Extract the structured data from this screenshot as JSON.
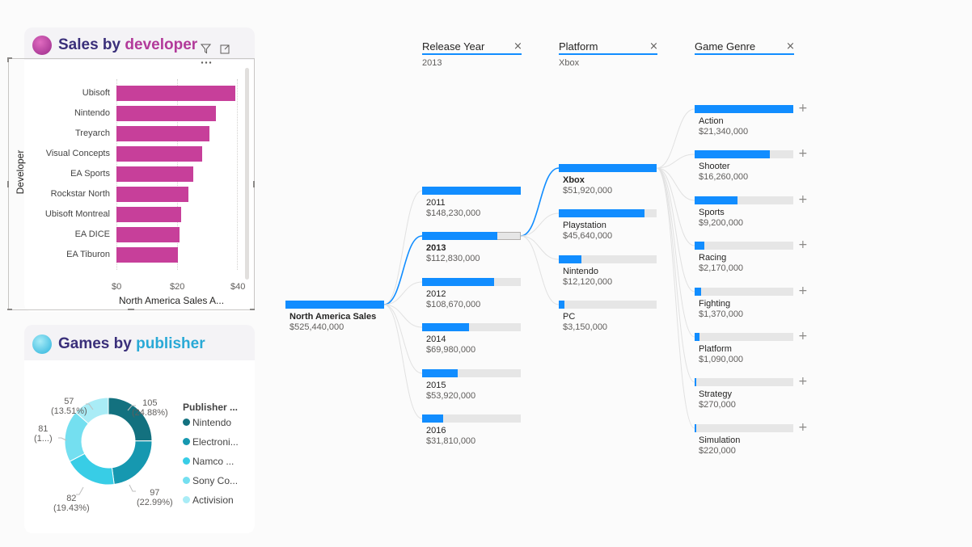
{
  "sales_by_developer": {
    "title_part1": "Sales by",
    "title_part2": "developer",
    "y_axis_label": "Developer",
    "x_axis_label": "North America Sales A...",
    "ticks": [
      "$0",
      "$20",
      "$40"
    ],
    "icons": [
      "filter-icon",
      "focus-mode-icon",
      "more-options-icon"
    ]
  },
  "games_by_publisher": {
    "title_part1": "Games by",
    "title_part2": "publisher",
    "legend_title": "Publisher ...",
    "legend": [
      {
        "label": "Nintendo",
        "color": "#13717f"
      },
      {
        "label": "Electroni...",
        "color": "#1698b0"
      },
      {
        "label": "Namco ...",
        "color": "#38cde6"
      },
      {
        "label": "Sony Co...",
        "color": "#74dff0"
      },
      {
        "label": "Activision",
        "color": "#a9ecf6"
      }
    ],
    "labels": {
      "l105": "105",
      "p105": "(24.88%)",
      "l97": "97",
      "p97": "(22.99%)",
      "l82": "82",
      "p82": "(19.43%)",
      "l81": "81",
      "p81": "(1...)",
      "l57": "57",
      "p57": "(13.51%)"
    }
  },
  "chart_data": [
    {
      "type": "bar",
      "orientation": "horizontal",
      "title": "Sales by developer",
      "ylabel": "Developer",
      "xlabel": "North America Sales A...",
      "categories": [
        "Ubisoft",
        "Nintendo",
        "Treyarch",
        "Visual Concepts",
        "EA Sports",
        "Rockstar North",
        "Ubisoft Montreal",
        "EA DICE",
        "EA Tiburon"
      ],
      "values": [
        39.5,
        33,
        31,
        28.5,
        25.5,
        24,
        21.5,
        21,
        20.5
      ],
      "xlim": [
        0,
        42
      ],
      "color": "#c73f9a"
    },
    {
      "type": "pie",
      "variant": "donut",
      "title": "Games by publisher",
      "categories": [
        "Nintendo",
        "Electroni...",
        "Namco ...",
        "Sony Co...",
        "Activision"
      ],
      "values": [
        105,
        97,
        82,
        81,
        57
      ],
      "percent_labels": [
        "(24.88%)",
        "(22.99%)",
        "(19.43%)",
        "(1...)",
        "(13.51%)"
      ],
      "colors": [
        "#13717f",
        "#1698b0",
        "#38cde6",
        "#74dff0",
        "#a9ecf6"
      ]
    }
  ],
  "decomposition_tree": {
    "root": {
      "name": "North America Sales",
      "value": "$525,440,000",
      "fraction": 1.0
    },
    "columns": [
      {
        "header": "Release Year",
        "filter": "2013",
        "close": "×"
      },
      {
        "header": "Platform",
        "filter": "Xbox",
        "close": "×"
      },
      {
        "header": "Game Genre",
        "filter": "",
        "close": "×"
      }
    ],
    "release_year": [
      {
        "name": "2011",
        "value": "$148,230,000",
        "fraction": 1.0
      },
      {
        "name": "2013",
        "value": "$112,830,000",
        "fraction": 0.76,
        "selected": true
      },
      {
        "name": "2012",
        "value": "$108,670,000",
        "fraction": 0.733
      },
      {
        "name": "2014",
        "value": "$69,980,000",
        "fraction": 0.472
      },
      {
        "name": "2015",
        "value": "$53,920,000",
        "fraction": 0.364
      },
      {
        "name": "2016",
        "value": "$31,810,000",
        "fraction": 0.215
      }
    ],
    "platform": [
      {
        "name": "Xbox",
        "value": "$51,920,000",
        "fraction": 1.0,
        "selected": true
      },
      {
        "name": "Playstation",
        "value": "$45,640,000",
        "fraction": 0.879
      },
      {
        "name": "Nintendo",
        "value": "$12,120,000",
        "fraction": 0.233
      },
      {
        "name": "PC",
        "value": "$3,150,000",
        "fraction": 0.061
      }
    ],
    "game_genre": [
      {
        "name": "Action",
        "value": "$21,340,000",
        "fraction": 1.0
      },
      {
        "name": "Shooter",
        "value": "$16,260,000",
        "fraction": 0.762
      },
      {
        "name": "Sports",
        "value": "$9,200,000",
        "fraction": 0.431
      },
      {
        "name": "Racing",
        "value": "$2,170,000",
        "fraction": 0.102
      },
      {
        "name": "Fighting",
        "value": "$1,370,000",
        "fraction": 0.064
      },
      {
        "name": "Platform",
        "value": "$1,090,000",
        "fraction": 0.051
      },
      {
        "name": "Strategy",
        "value": "$270,000",
        "fraction": 0.013
      },
      {
        "name": "Simulation",
        "value": "$220,000",
        "fraction": 0.01
      }
    ],
    "expand_label": "+"
  },
  "colors": {
    "accent_blue": "#118dff",
    "developer_bar": "#c73f9a",
    "title_dark": "#3a2f7a",
    "title_magenta": "#b23a9a",
    "title_cyan": "#29a9d6"
  }
}
